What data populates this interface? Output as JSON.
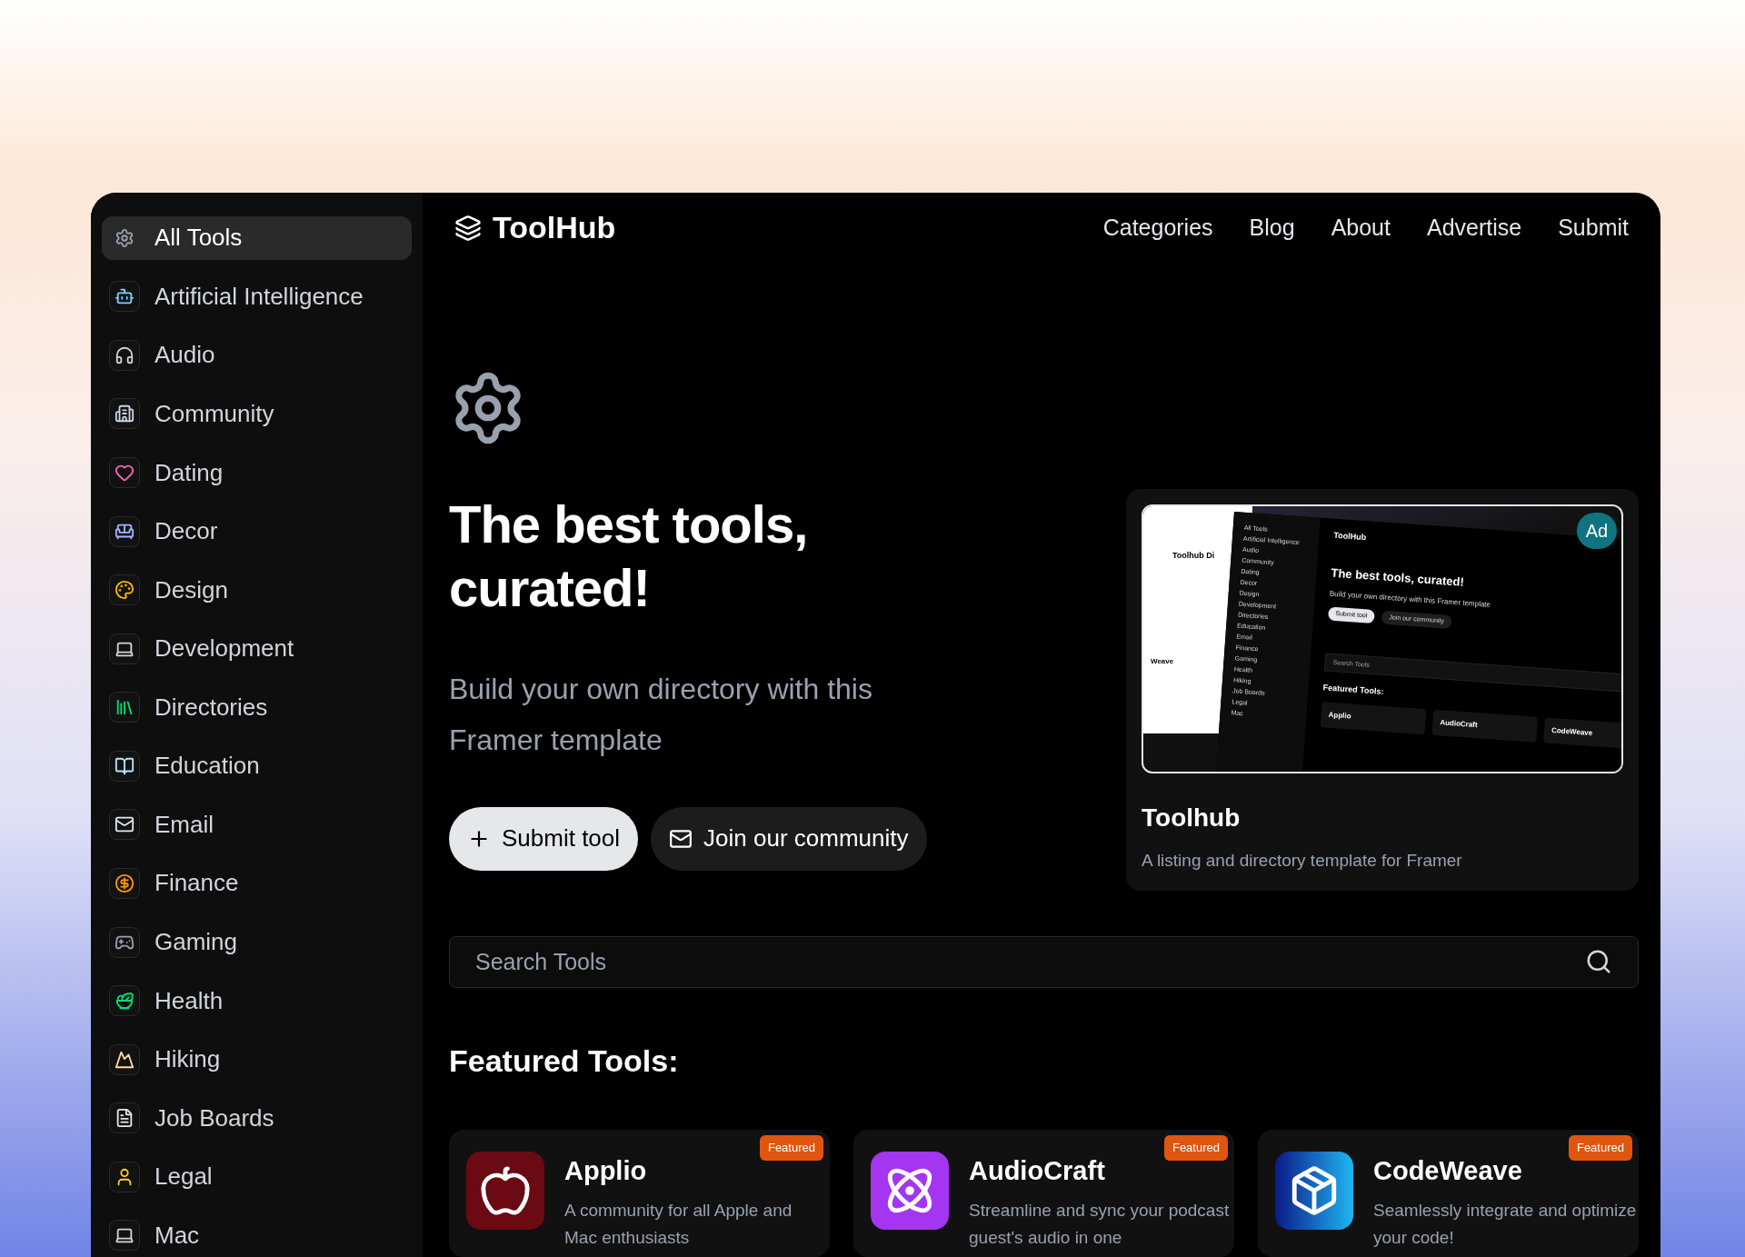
{
  "sidebar": {
    "items": [
      {
        "label": "All Tools",
        "selected": true
      },
      {
        "label": "Artificial Intelligence",
        "selected": false
      },
      {
        "label": "Audio",
        "selected": false
      },
      {
        "label": "Community",
        "selected": false
      },
      {
        "label": "Dating",
        "selected": false
      },
      {
        "label": "Decor",
        "selected": false
      },
      {
        "label": "Design",
        "selected": false
      },
      {
        "label": "Development",
        "selected": false
      },
      {
        "label": "Directories",
        "selected": false
      },
      {
        "label": "Education",
        "selected": false
      },
      {
        "label": "Email",
        "selected": false
      },
      {
        "label": "Finance",
        "selected": false
      },
      {
        "label": "Gaming",
        "selected": false
      },
      {
        "label": "Health",
        "selected": false
      },
      {
        "label": "Hiking",
        "selected": false
      },
      {
        "label": "Job Boards",
        "selected": false
      },
      {
        "label": "Legal",
        "selected": false
      },
      {
        "label": "Mac",
        "selected": false
      }
    ]
  },
  "header": {
    "brand": "ToolHub",
    "nav": [
      "Categories",
      "Blog",
      "About",
      "Advertise",
      "Submit"
    ]
  },
  "hero": {
    "title": "The best tools, curated!",
    "subtitle": "Build your own directory with this Framer template",
    "buttons": [
      {
        "label": "Submit tool",
        "kind": "primary"
      },
      {
        "label": "Join our community",
        "kind": "secondary"
      }
    ]
  },
  "ad": {
    "badge": "Ad",
    "title": "Toolhub",
    "description": "A listing and directory template for Framer",
    "preview": {
      "back_title": "Toolhub Di",
      "back_tool": "Weave",
      "sidebar": [
        "All Tools",
        "Artificial Intelligence",
        "Audio",
        "Community",
        "Dating",
        "Decor",
        "Design",
        "Development",
        "Directories",
        "Education",
        "Email",
        "Finance",
        "Gaming",
        "Health",
        "Hiking",
        "Job Boards",
        "Legal",
        "Mac"
      ],
      "brand": "ToolHub",
      "title": "The best tools, curated!",
      "subtitle": "Build your own directory with this Framer template",
      "buttons": [
        "Submit tool",
        "Join our community"
      ],
      "search": "Search Tools",
      "heading": "Featured Tools:",
      "tools": [
        "Applio",
        "AudioCraft",
        "CodeWeave"
      ]
    }
  },
  "search": {
    "placeholder": "Search Tools"
  },
  "featured": {
    "heading": "Featured Tools:",
    "tools": [
      {
        "name": "Applio",
        "description": "A community for all Apple and Mac enthusiasts",
        "badge": "Featured",
        "kind": "apple"
      },
      {
        "name": "AudioCraft",
        "description": "Streamline and sync your podcast guest's audio in one",
        "badge": "Featured",
        "kind": "atom"
      },
      {
        "name": "CodeWeave",
        "description": "Seamlessly integrate and optimize your code!",
        "badge": "Featured",
        "kind": "box"
      }
    ]
  }
}
